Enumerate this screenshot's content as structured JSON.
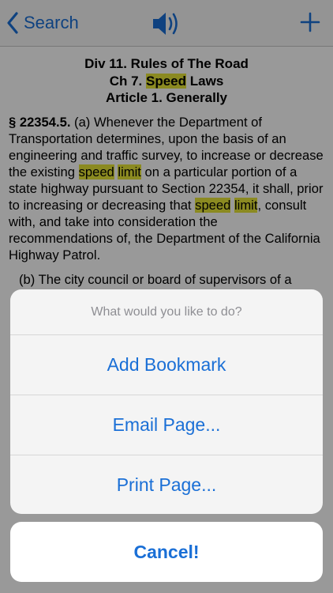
{
  "navbar": {
    "back_label": "Search",
    "speaker_icon": "speaker-icon",
    "add_icon": "plus-icon"
  },
  "document": {
    "heading_line1": "Div 11. Rules of The Road",
    "heading_line2_pre": "Ch 7. ",
    "heading_line2_hl": "Speed",
    "heading_line2_post": " Laws",
    "heading_line3": "Article 1. Generally",
    "p1": {
      "code": "§ 22354.5.",
      "t1": " (a) Whenever the Department of Transportation determines, upon the basis of an engineering and traffic survey, to increase or decrease the existing ",
      "hl1": "speed",
      "t2": " ",
      "hl2": "limit",
      "t3": " on a particular portion of a state highway pursuant to Section 22354, it shall, prior to increasing or decreasing that ",
      "hl3": "speed",
      "t4": " ",
      "hl4": "limit",
      "t5": ", consult with, and take into consideration the recommendations of, the Department of the California Highway Patrol."
    },
    "p2": "(b) The city council or board of supervisors of a"
  },
  "action_sheet": {
    "title": "What would you like to do?",
    "actions": [
      "Add Bookmark",
      "Email Page...",
      "Print Page..."
    ],
    "cancel": "Cancel!"
  },
  "colors": {
    "accent": "#1a6fd6",
    "highlight": "#e8e637"
  }
}
